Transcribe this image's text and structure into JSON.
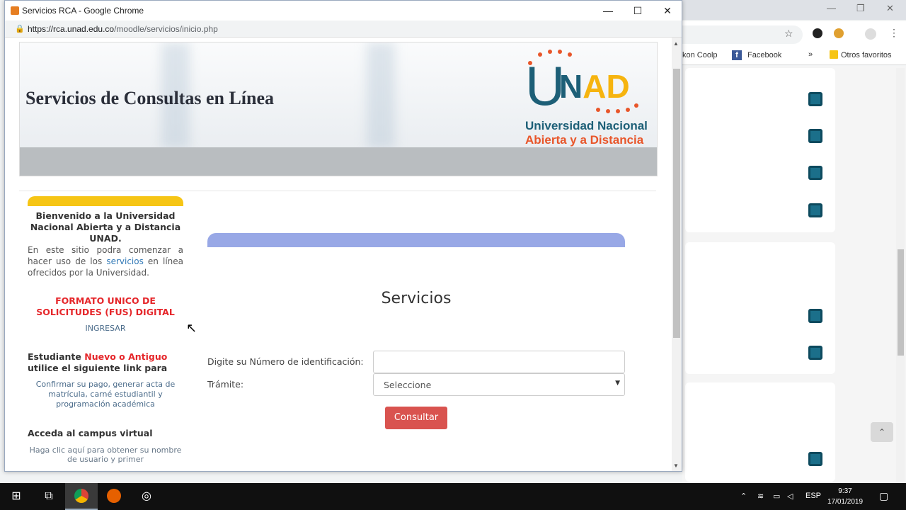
{
  "popup": {
    "title": "Servicios RCA - Google Chrome",
    "url_host": "https://rca.unad.edu.co",
    "url_path": "/moodle/servicios/inicio.php",
    "controls": {
      "minimize": "—",
      "maximize": "☐",
      "close": "✕"
    }
  },
  "header": {
    "title": "Servicios de Consultas en Línea",
    "logo": {
      "u": "U",
      "n": "N",
      "ad": "AD",
      "line1": "Universidad Nacional",
      "line2": "Abierta y a Distancia"
    }
  },
  "sidebar": {
    "welcome": "Bienvenido a la Universidad Nacional Abierta y a Distancia UNAD.",
    "intro_pre": "En este sitio podra comenzar a hacer uso de los ",
    "intro_link": "servicios",
    "intro_post": " en línea ofrecidos por la Universidad.",
    "fus_title": "FORMATO UNICO DE SOLICITUDES (FUS) DIGITAL",
    "fus_link": "INGRESAR",
    "student_a": "Estudiante ",
    "student_b": "Nuevo o Antiguo",
    "student_c": " utilice el siguiente link para",
    "confirm_link": "Confirmar su pago, generar acta de matrícula, carné estudiantil y programación académica",
    "campus_title": "Acceda al campus virtual",
    "campus_text": "Haga clic aquí para obtener su nombre de usuario y primer"
  },
  "main": {
    "heading": "Servicios",
    "id_label": "Digite su Número de identificación:",
    "id_value": "",
    "tramite_label": "Trámite:",
    "tramite_selected": "Seleccione",
    "submit": "Consultar"
  },
  "background": {
    "bookmarks": [
      "kon Coolp",
      "Facebook",
      "»",
      "Otros favoritos"
    ],
    "scroll_up": "⌃"
  },
  "taskbar": {
    "lang": "ESP",
    "time": "9:37",
    "date": "17/01/2019"
  },
  "colors": {
    "unad_blue": "#1d5f77",
    "unad_orange": "#e8562a",
    "unad_yellow": "#f6c515",
    "button_red": "#d9534f",
    "fus_red": "#e5262a"
  }
}
